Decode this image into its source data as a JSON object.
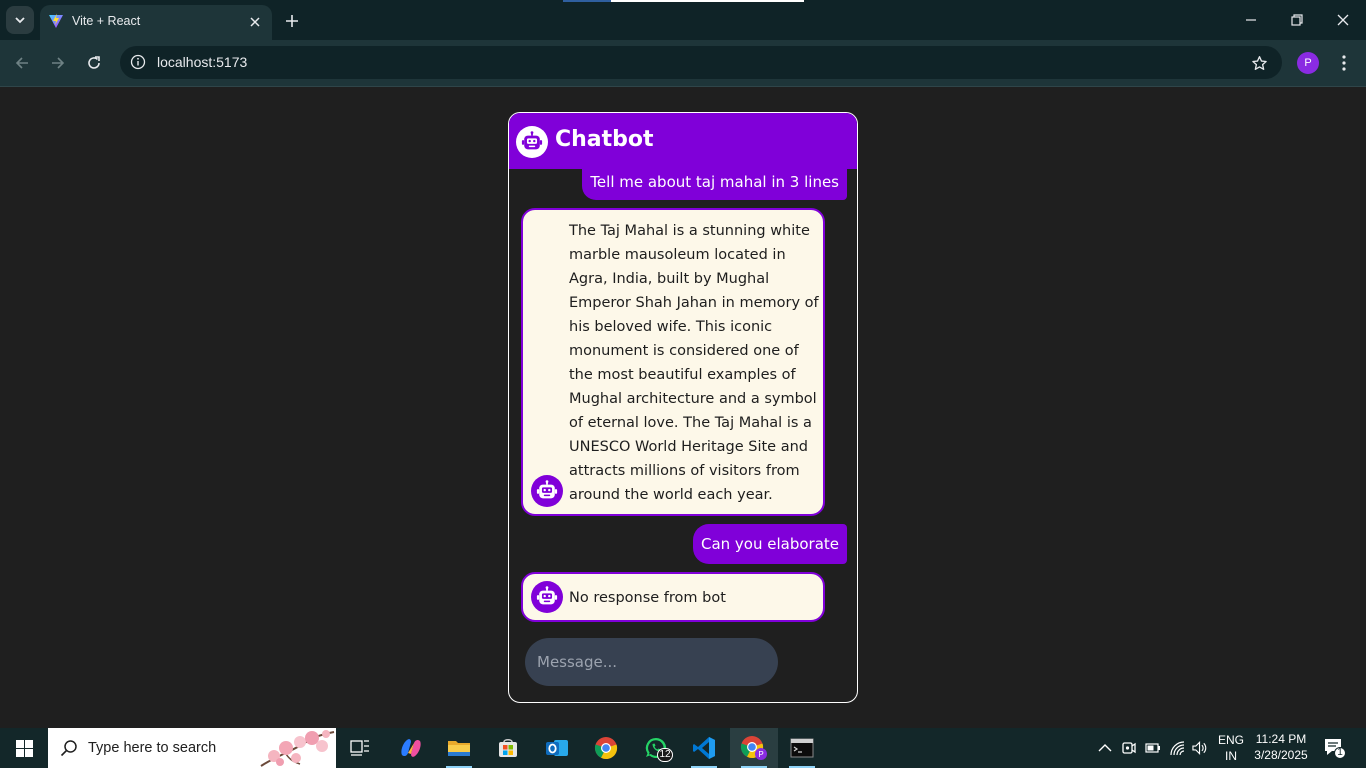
{
  "browser": {
    "tab_title": "Vite + React",
    "url": "localhost:5173",
    "profile_initial": "P"
  },
  "chatbot": {
    "title": "Chatbot",
    "messages": [
      {
        "role": "user",
        "text": "Tell me about taj mahal in 3 lines"
      },
      {
        "role": "bot",
        "text": "The Taj Mahal is a stunning white\nmarble mausoleum located in\nAgra, India, built by Mughal\nEmperor Shah Jahan in memory of\nhis beloved wife. This iconic\nmonument is considered one of\nthe most beautiful examples of\nMughal architecture and a symbol\nof eternal love. The Taj Mahal is a\nUNESCO World Heritage Site and\nattracts millions of visitors from\naround the world each year."
      },
      {
        "role": "user",
        "text": "Can you elaborate"
      },
      {
        "role": "bot",
        "text": "No response from bot"
      }
    ],
    "input_placeholder": "Message..."
  },
  "taskbar": {
    "search_placeholder": "Type here to search",
    "whatsapp_badge": "12",
    "language_line1": "ENG",
    "language_line2": "IN",
    "time": "11:24 PM",
    "date": "3/28/2025",
    "notification_count": "1"
  },
  "colors": {
    "accent_purple": "#8000d9",
    "bot_bubble": "#fdf8e9",
    "page_bg": "#1f1f1f",
    "chrome_dark": "#0f2327",
    "chrome_toolbar": "#1e3539"
  }
}
